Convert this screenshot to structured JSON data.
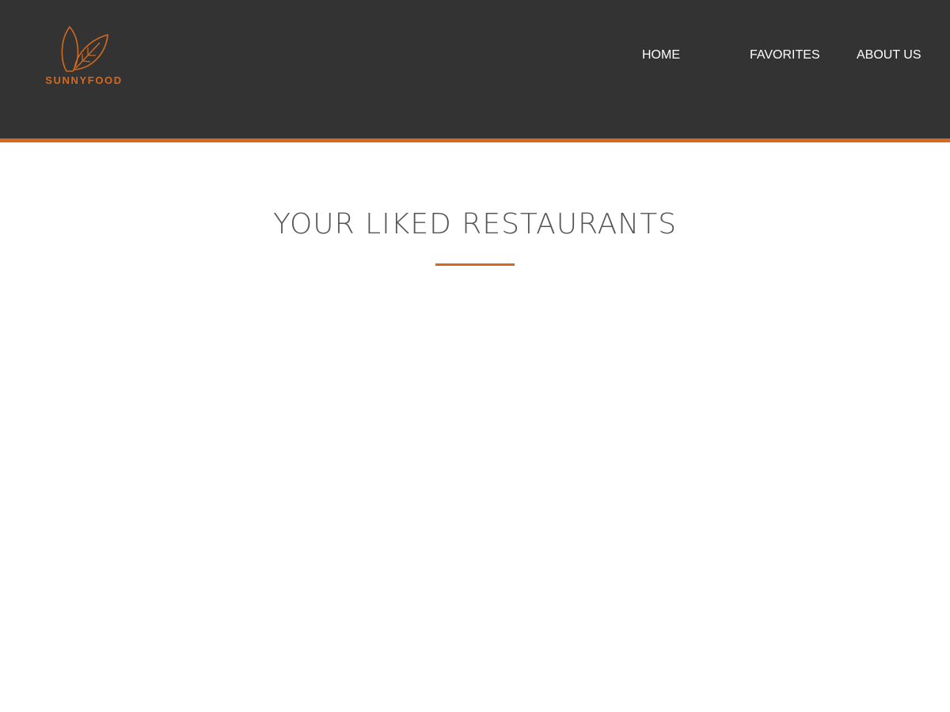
{
  "brand": {
    "name": "SUNNYFOOD",
    "accent_color": "#d2691e",
    "header_color": "#333333",
    "icon": "leaves-logo-icon"
  },
  "nav": {
    "items": [
      {
        "label": "HOME"
      },
      {
        "label": "FAVORITES"
      },
      {
        "label": "ABOUT US"
      }
    ]
  },
  "main": {
    "title": "YOUR LIKED RESTAURANTS",
    "restaurants": []
  }
}
